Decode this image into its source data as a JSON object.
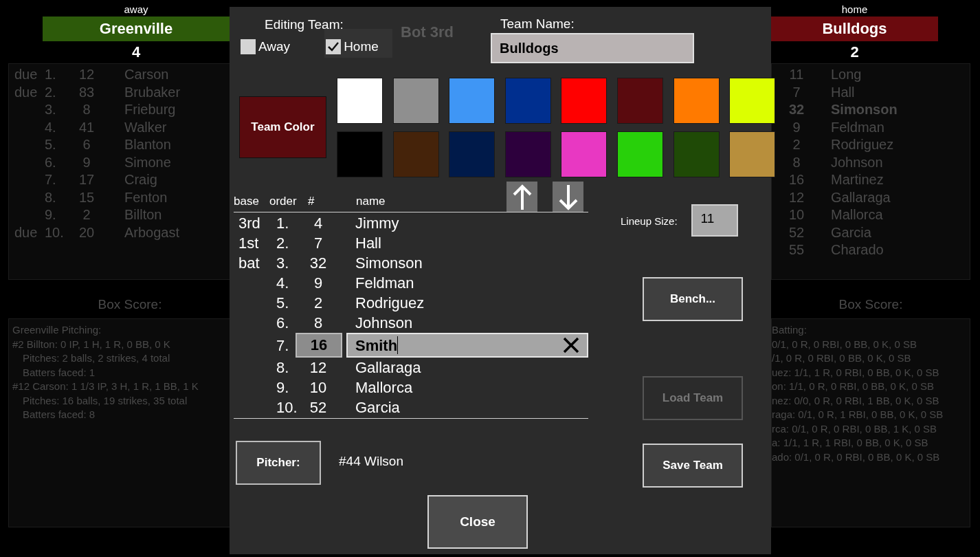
{
  "away": {
    "label": "away",
    "name": "Greenville",
    "color": "#2d5a0a",
    "score": "4",
    "lineup": [
      {
        "base": "due",
        "order": "1.",
        "number": "12",
        "name": "Carson",
        "current": false
      },
      {
        "base": "due",
        "order": "2.",
        "number": "83",
        "name": "Brubaker",
        "current": false
      },
      {
        "order": "3.",
        "number": "8",
        "name": "Frieburg",
        "current": false
      },
      {
        "order": "4.",
        "number": "41",
        "name": "Walker",
        "current": false
      },
      {
        "order": "5.",
        "number": "6",
        "name": "Blanton",
        "current": false
      },
      {
        "order": "6.",
        "number": "9",
        "name": "Simone",
        "current": false
      },
      {
        "order": "7.",
        "number": "17",
        "name": "Craig",
        "current": false
      },
      {
        "order": "8.",
        "number": "15",
        "name": "Fenton",
        "current": false
      },
      {
        "order": "9.",
        "number": "2",
        "name": "Billton",
        "current": false
      },
      {
        "base": "due",
        "order": "10.",
        "number": "20",
        "name": "Arbogast",
        "current": false
      }
    ],
    "box_title": "Box Score:",
    "box": {
      "heading": "Greenville Pitching:",
      "entries": [
        {
          "text": "#2 Billton: 0 IP, 1 H, 1 R, 0 BB, 0 K",
          "children": [
            "Pitches: 2 balls, 2 strikes, 4 total",
            "Batters faced: 1"
          ]
        },
        {
          "text": "#12 Carson: 1 1/3 IP, 3 H, 1 R, 1 BB, 1 K",
          "children": [
            "Pitches: 16 balls, 19 strikes, 35 total",
            "Batters faced: 8"
          ]
        }
      ]
    }
  },
  "behind_dialog": "Bot 3rd",
  "home": {
    "label": "home",
    "name": "Bulldogs",
    "color": "#6b0a0e",
    "score": "2",
    "lineup": [
      {
        "number": "11",
        "name": "Long",
        "current": false
      },
      {
        "number": "7",
        "name": "Hall",
        "current": false
      },
      {
        "number": "32",
        "name": "Simonson",
        "current": true
      },
      {
        "number": "9",
        "name": "Feldman",
        "current": false
      },
      {
        "number": "2",
        "name": "Rodriguez",
        "current": false
      },
      {
        "number": "8",
        "name": "Johnson",
        "current": false
      },
      {
        "number": "16",
        "name": "Martinez",
        "current": false
      },
      {
        "number": "12",
        "name": "Gallaraga",
        "current": false
      },
      {
        "number": "10",
        "name": "Mallorca",
        "current": false
      },
      {
        "number": "52",
        "name": "Garcia",
        "current": false
      },
      {
        "number": "55",
        "name": "Charado",
        "current": false
      }
    ],
    "box_title": "Box Score:",
    "box": {
      "heading": "Batting:",
      "lines": [
        "0/1, 0 R, 0 RBI, 0 BB, 0 K, 0 SB",
        "/1, 0 R, 0 RBI, 0 BB, 0 K, 0 SB",
        "uez: 1/1, 1 R, 0 RBI, 0 BB, 0 K, 0 SB",
        "on: 1/1, 0 R, 0 RBI, 0 BB, 0 K, 0 SB",
        "nez: 0/0, 0 R, 0 RBI, 1 BB, 0 K, 0 SB",
        "raga: 0/1, 0 R, 1 RBI, 0 BB, 0 K, 0 SB",
        "rca: 0/1, 0 R, 0 RBI, 0 BB, 1 K, 0 SB",
        "a: 1/1, 1 R, 1 RBI, 0 BB, 0 K, 0 SB",
        "ado: 0/1, 0 R, 0 RBI, 0 BB, 0 K, 0 SB"
      ]
    }
  },
  "dialog": {
    "editing_label": "Editing Team:",
    "team_options": [
      {
        "label": "Away",
        "checked": false
      },
      {
        "label": "Home",
        "checked": true
      }
    ],
    "team_name_label": "Team Name:",
    "team_name": "Bulldogs",
    "team_color_button": {
      "label": "Team Color",
      "color": "#5a0a0e"
    },
    "swatches": [
      {
        "color": "#ffffff"
      },
      {
        "color": "#8f8f8f"
      },
      {
        "color": "#3f96f5"
      },
      {
        "color": "#002f8f"
      },
      {
        "color": "#ff0000"
      },
      {
        "color": "#5a0a0e"
      },
      {
        "color": "#ff7a00"
      },
      {
        "color": "#dcff00"
      },
      {
        "color": "#000000"
      },
      {
        "color": "#45230a"
      },
      {
        "color": "#001a4a"
      },
      {
        "color": "#2d003d"
      },
      {
        "color": "#e838c2"
      },
      {
        "color": "#28d00a"
      },
      {
        "color": "#1f4a06"
      },
      {
        "color": "#b88f3c"
      }
    ],
    "columns": [
      "base",
      "order",
      "#",
      "name"
    ],
    "lineup": [
      {
        "kind": "row",
        "base": "3rd",
        "order": "1.",
        "number": "4",
        "name": "Jimmy"
      },
      {
        "kind": "row",
        "base": "1st",
        "order": "2.",
        "number": "7",
        "name": "Hall"
      },
      {
        "kind": "row",
        "base": "bat",
        "order": "3.",
        "number": "32",
        "name": "Simonson"
      },
      {
        "kind": "row",
        "order": "4.",
        "number": "9",
        "name": "Feldman"
      },
      {
        "kind": "row",
        "order": "5.",
        "number": "2",
        "name": "Rodriguez"
      },
      {
        "kind": "row",
        "order": "6.",
        "number": "8",
        "name": "Johnson"
      },
      {
        "kind": "editing",
        "order": "7.",
        "number": "16",
        "name": "Smith"
      },
      {
        "kind": "row",
        "order": "8.",
        "number": "12",
        "name": "Gallaraga"
      },
      {
        "kind": "row",
        "order": "9.",
        "number": "10",
        "name": "Mallorca"
      },
      {
        "kind": "row",
        "order": "10.",
        "number": "52",
        "name": "Garcia"
      }
    ],
    "lineup_size_label": "Lineup Size:",
    "lineup_size": "11",
    "buttons": [
      {
        "label": "Bench...",
        "disabled": false
      },
      {
        "label": "Load Team",
        "disabled": true
      },
      {
        "label": "Save Team",
        "disabled": false
      }
    ],
    "pitcher_button": "Pitcher:",
    "pitcher": "#44 Wilson",
    "close": "Close"
  }
}
